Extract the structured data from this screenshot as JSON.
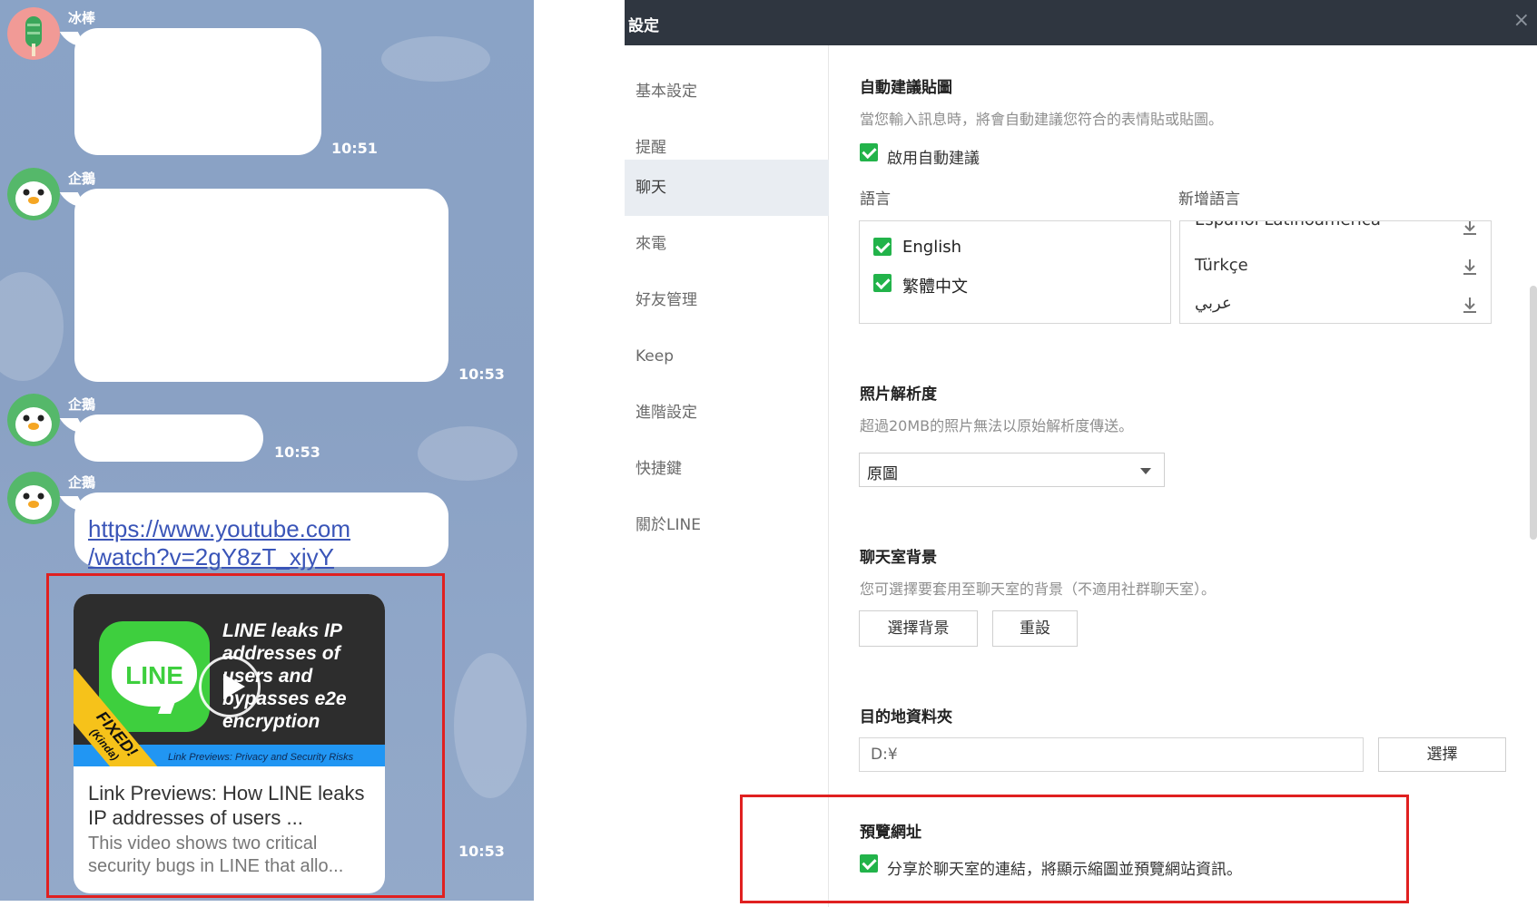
{
  "chat": {
    "messages": [
      {
        "sender": "冰棒",
        "time": "10:51"
      },
      {
        "sender": "企鵝",
        "time": "10:53"
      },
      {
        "sender": "企鵝",
        "time": "10:53"
      },
      {
        "sender": "企鵝",
        "time": "10:53"
      }
    ],
    "link_url": "https://www.youtube.com\n/watch?v=2gY8zT_xjyY",
    "preview": {
      "thumb_title": "LINE leaks IP addresses of users and bypasses e2e encryption",
      "ribbon_main": "FIXED!",
      "ribbon_sub": "(Kinda)",
      "logo_text": "LINE",
      "banner_text": "Link Previews: Privacy and Security Risks",
      "title": "Link Previews: How LINE leaks IP addresses of users ...",
      "description": "This video shows two critical security bugs in LINE that allo..."
    }
  },
  "settings": {
    "window_title": "設定",
    "close_glyph": "×",
    "nav": [
      "基本設定",
      "提醒",
      "聊天",
      "來電",
      "好友管理",
      "Keep",
      "進階設定",
      "快捷鍵",
      "關於LINE"
    ],
    "active_nav": "聊天",
    "auto_suggest": {
      "title": "自動建議貼圖",
      "desc": "當您輸入訊息時，將會自動建議您符合的表情貼或貼圖。",
      "checkbox": "啟用自動建議"
    },
    "language": {
      "label": "語言",
      "add_label": "新增語言",
      "selected": [
        "English",
        "繁體中文"
      ],
      "available": [
        "Español Latinoamérica",
        "Türkçe",
        "عربي"
      ]
    },
    "photo": {
      "title": "照片解析度",
      "desc": "超過20MB的照片無法以原始解析度傳送。",
      "selected": "原圖"
    },
    "background": {
      "title": "聊天室背景",
      "desc": "您可選擇要套用至聊天室的背景（不適用社群聊天室）。",
      "choose_btn": "選擇背景",
      "reset_btn": "重設"
    },
    "folder": {
      "title": "目的地資料夾",
      "value": "D:¥",
      "choose_btn": "選擇"
    },
    "preview_url": {
      "title": "預覽網址",
      "checkbox": "分享於聊天室的連結，將顯示縮圖並預覽網站資訊。"
    }
  },
  "colors": {
    "chat_bg": "#8aa3c6",
    "accent_green": "#22b34a",
    "highlight_red": "#e02020",
    "titlebar": "#2f3640"
  }
}
